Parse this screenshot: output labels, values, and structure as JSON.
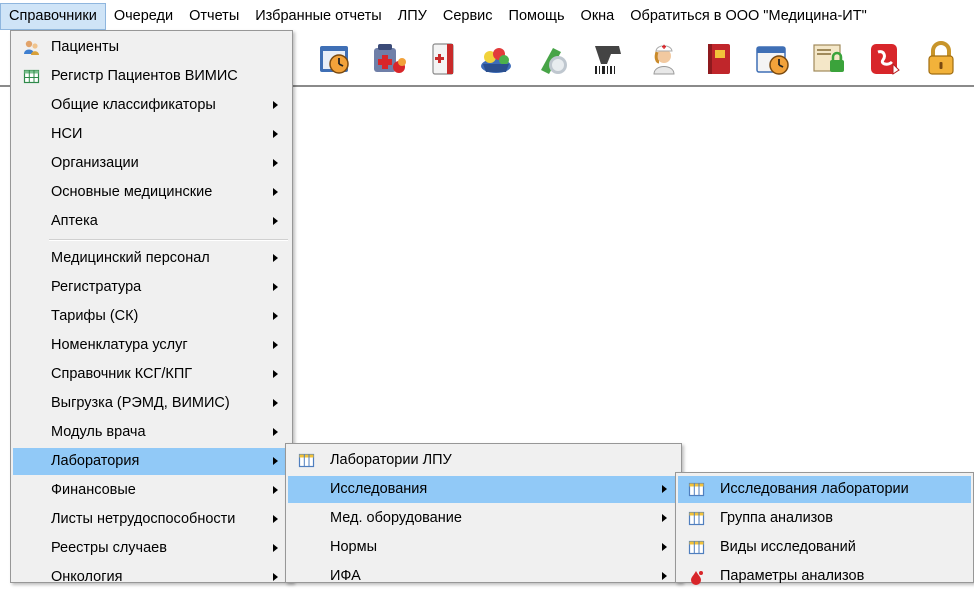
{
  "menubar": {
    "items": [
      "Справочники",
      "Очереди",
      "Отчеты",
      "Избранные отчеты",
      "ЛПУ",
      "Сервис",
      "Помощь",
      "Окна",
      "Обратиться в ООО \"Медицина-ИТ\""
    ]
  },
  "toolbar": {
    "icons": [
      "calendar-clock-icon",
      "medical-kit-icon",
      "medical-cabinet-icon",
      "pills-basket-icon",
      "capsule-icon",
      "barcode-scanner-icon",
      "nurse-icon",
      "red-book-icon",
      "calendar-clock-icon",
      "lock-document-icon",
      "pdf-icon",
      "padlock-icon"
    ]
  },
  "menu1": {
    "items": [
      "Пациенты",
      "Регистр Пациентов ВИМИС",
      "Общие классификаторы",
      "НСИ",
      "Организации",
      "Основные медицинские",
      "Аптека",
      "Медицинский персонал",
      "Регистратура",
      "Тарифы (СК)",
      "Номенклатура услуг",
      "Справочник КСГ/КПГ",
      "Выгрузка (РЭМД, ВИМИС)",
      "Модуль врача",
      "Лаборатория",
      "Финансовые",
      "Листы нетрудоспособности",
      "Реестры случаев",
      "Онкология"
    ]
  },
  "menu2": {
    "items": [
      "Лаборатории ЛПУ",
      "Исследования",
      "Мед. оборудование",
      "Нормы",
      "ИФА"
    ]
  },
  "menu3": {
    "items": [
      "Исследования лаборатории",
      "Группа анализов",
      "Виды исследований",
      "Параметры анализов"
    ]
  },
  "colors": {
    "highlight": "#91c9f7",
    "menu_bg": "#f0f0f0",
    "active_menubar": "#cfe4f7"
  }
}
